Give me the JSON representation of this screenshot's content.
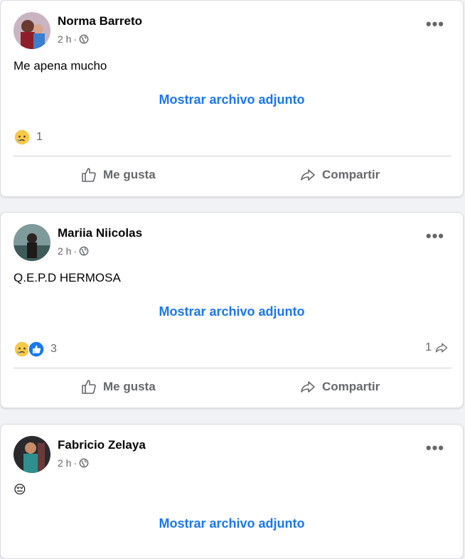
{
  "posts": [
    {
      "author": "Norma Barreto",
      "time": "2 h",
      "separator": "·",
      "text": "Me apena mucho",
      "attachment_label": "Mostrar archivo adjunto",
      "reactions": [
        "sad"
      ],
      "reaction_count": "1",
      "share_count": "",
      "like_label": "Me gusta",
      "share_label": "Compartir"
    },
    {
      "author": "Mariia Niicolas",
      "time": "2 h",
      "separator": "·",
      "text": "Q.E.P.D HERMOSA",
      "attachment_label": "Mostrar archivo adjunto",
      "reactions": [
        "sad",
        "like"
      ],
      "reaction_count": "3",
      "share_count": "1",
      "like_label": "Me gusta",
      "share_label": "Compartir"
    },
    {
      "author": "Fabricio Zelaya",
      "time": "2 h",
      "separator": "·",
      "text": "😔",
      "attachment_label": "Mostrar archivo adjunto"
    }
  ],
  "colors": {
    "link": "#1877f2",
    "secondary": "#65676b",
    "background": "#f0f2f5"
  }
}
